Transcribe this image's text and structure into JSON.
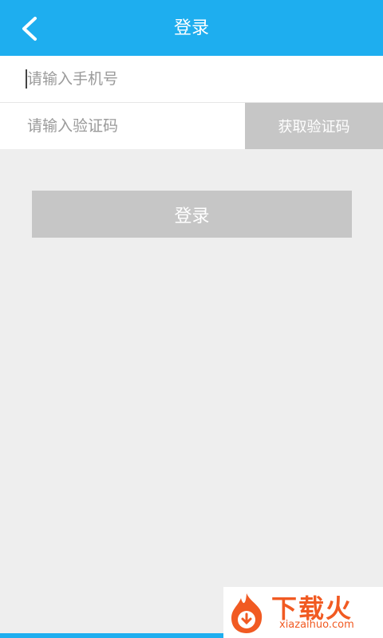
{
  "header": {
    "title": "登录",
    "back_icon": "chevron-left-icon"
  },
  "form": {
    "phone_placeholder": "请输入手机号",
    "code_placeholder": "请输入验证码",
    "get_code_label": "获取验证码",
    "login_label": "登录"
  },
  "watermark": {
    "brand": "下载火",
    "domain": "xiazaihuo.com"
  },
  "colors": {
    "accent": "#1eaeef",
    "button_disabled": "#c6c6c6",
    "background": "#eeeeee"
  }
}
